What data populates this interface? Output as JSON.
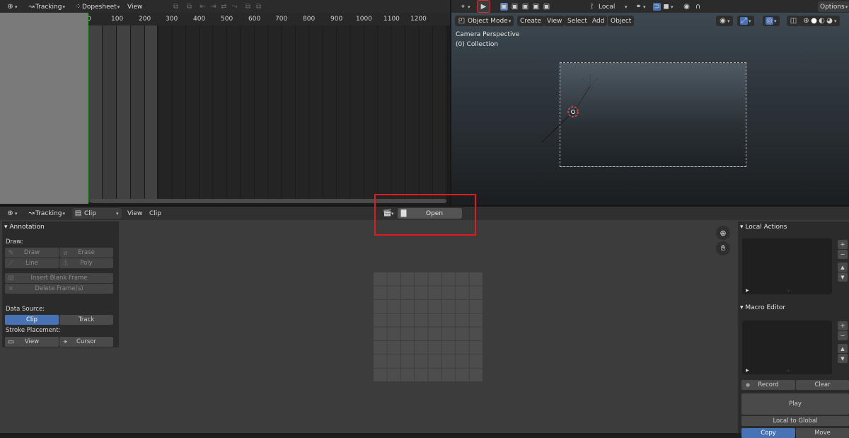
{
  "dopesheet": {
    "header": {
      "mode": "Tracking",
      "editor": "Dopesheet",
      "view": "View"
    },
    "ruler_ticks": [
      "0",
      "100",
      "200",
      "300",
      "400",
      "500",
      "600",
      "700",
      "800",
      "900",
      "1000",
      "1100",
      "1200"
    ]
  },
  "viewport": {
    "header": {
      "orientation": "Local",
      "options": "Options"
    },
    "toolbar": {
      "mode": "Object Mode",
      "create": "Create",
      "view": "View",
      "select": "Select",
      "add": "Add",
      "object": "Object"
    },
    "overlay_text": {
      "perspective": "Camera Perspective",
      "collection": "(0) Collection"
    }
  },
  "clip_editor": {
    "header": {
      "mode": "Tracking",
      "editor": "Clip",
      "view": "View",
      "clip": "Clip",
      "open": "Open"
    },
    "annotation": {
      "title": "Annotation",
      "draw_label": "Draw:",
      "draw": "Draw",
      "erase": "Erase",
      "line": "Line",
      "poly": "Poly",
      "insert_blank": "Insert Blank Frame",
      "delete_frames": "Delete Frame(s)",
      "data_source_label": "Data Source:",
      "source_clip": "Clip",
      "source_track": "Track",
      "stroke_label": "Stroke Placement:",
      "stroke_view": "View",
      "stroke_cursor": "Cursor"
    },
    "sidebar": {
      "local_actions": "Local Actions",
      "macro_editor": "Macro Editor",
      "record": "Record",
      "clear": "Clear",
      "play": "Play",
      "local_to_global": "Local to Global",
      "copy": "Copy",
      "move": "Move"
    }
  },
  "colors": {
    "accent": "#4772b3",
    "highlight_box": "#e01b1b",
    "playhead": "#3fa03f"
  }
}
